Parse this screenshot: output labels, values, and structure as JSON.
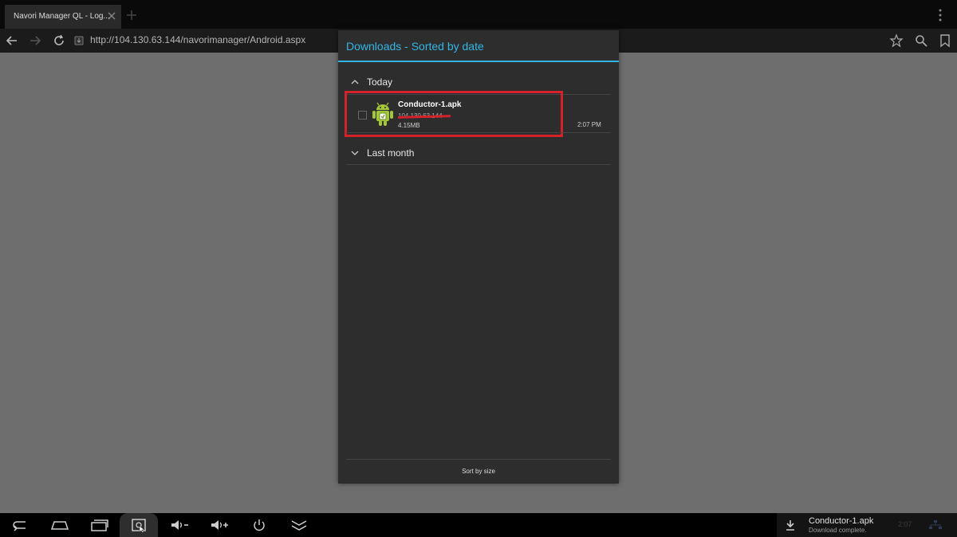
{
  "browser": {
    "tab_title": "Navori Manager QL - Log...",
    "url": "http://104.130.63.144/navorimanager/Android.aspx"
  },
  "dialog": {
    "title": "Downloads - Sorted by date",
    "groups": [
      {
        "label": "Today",
        "expanded": true
      },
      {
        "label": "Last month",
        "expanded": false
      }
    ],
    "item": {
      "name": "Conductor-1.apk",
      "source": "104.130.63.144",
      "size": "4.15MB",
      "time": "2:07 PM",
      "icon": "android-apk-icon"
    },
    "sort_button": "Sort by size",
    "accent": "#33b5e5",
    "highlight_color": "#d3222a"
  },
  "notification": {
    "title": "Conductor-1.apk",
    "subtitle": "Download complete.",
    "faded_text": "2:07"
  }
}
